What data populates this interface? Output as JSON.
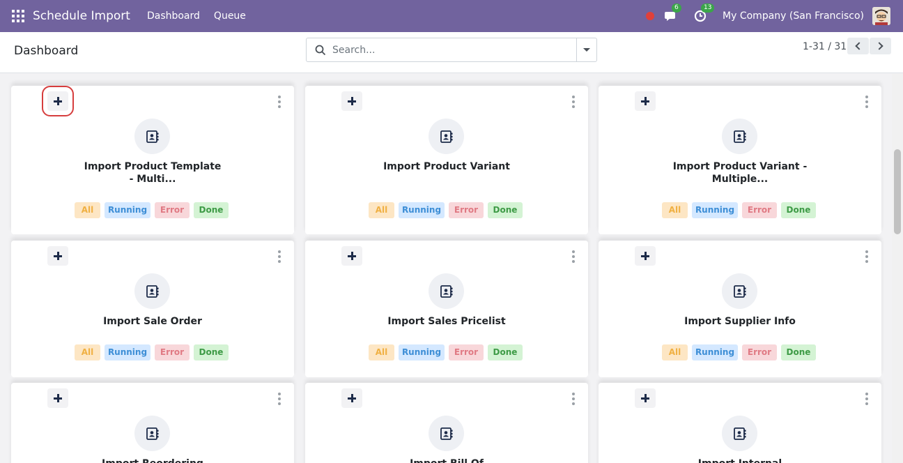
{
  "app": {
    "brand": "Schedule Import",
    "menu": [
      "Dashboard",
      "Queue"
    ],
    "messages_count": "6",
    "activities_count": "13",
    "company": "My Company (San Francisco)"
  },
  "control": {
    "title": "Dashboard",
    "search_placeholder": "Search...",
    "pager": "1-31 / 31"
  },
  "tags": {
    "all": "All",
    "running": "Running",
    "error": "Error",
    "done": "Done"
  },
  "colors": {
    "navbar": "#71639e",
    "highlight": "#d63d3d"
  },
  "cards": [
    {
      "title": "Import Product Template - Multi..."
    },
    {
      "title": "Import Product Variant"
    },
    {
      "title": "Import Product Variant - Multiple..."
    },
    {
      "title": "Import Sale Order"
    },
    {
      "title": "Import Sales Pricelist"
    },
    {
      "title": "Import Supplier Info"
    },
    {
      "title": "Import Reordering"
    },
    {
      "title": "Import Bill Of"
    },
    {
      "title": "Import Internal"
    }
  ]
}
